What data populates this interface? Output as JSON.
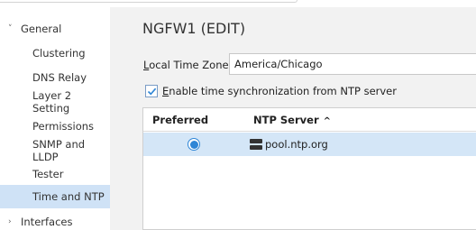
{
  "sidebar": {
    "group_general": "General",
    "items": [
      {
        "label": "Clustering"
      },
      {
        "label": "DNS Relay"
      },
      {
        "label": "Layer 2 Setting"
      },
      {
        "label": "Permissions"
      },
      {
        "label": "SNMP and LLDP"
      },
      {
        "label": "Tester"
      },
      {
        "label": "Time and NTP",
        "selected": true
      }
    ],
    "group_interfaces": "Interfaces",
    "selected_color": "#cfe2f6"
  },
  "main": {
    "title": "NGFW1 (EDIT)",
    "timezone_label_accel": "L",
    "timezone_label_rest": "ocal Time Zone:",
    "timezone_value": "America/Chicago",
    "ntp_checkbox_checked": true,
    "ntp_checkbox_label_accel": "E",
    "ntp_checkbox_label_rest": "nable time synchronization from NTP server",
    "table": {
      "headers": {
        "preferred": "Preferred",
        "server": "NTP Server"
      },
      "rows": [
        {
          "preferred": true,
          "server": "pool.ntp.org"
        }
      ]
    }
  }
}
